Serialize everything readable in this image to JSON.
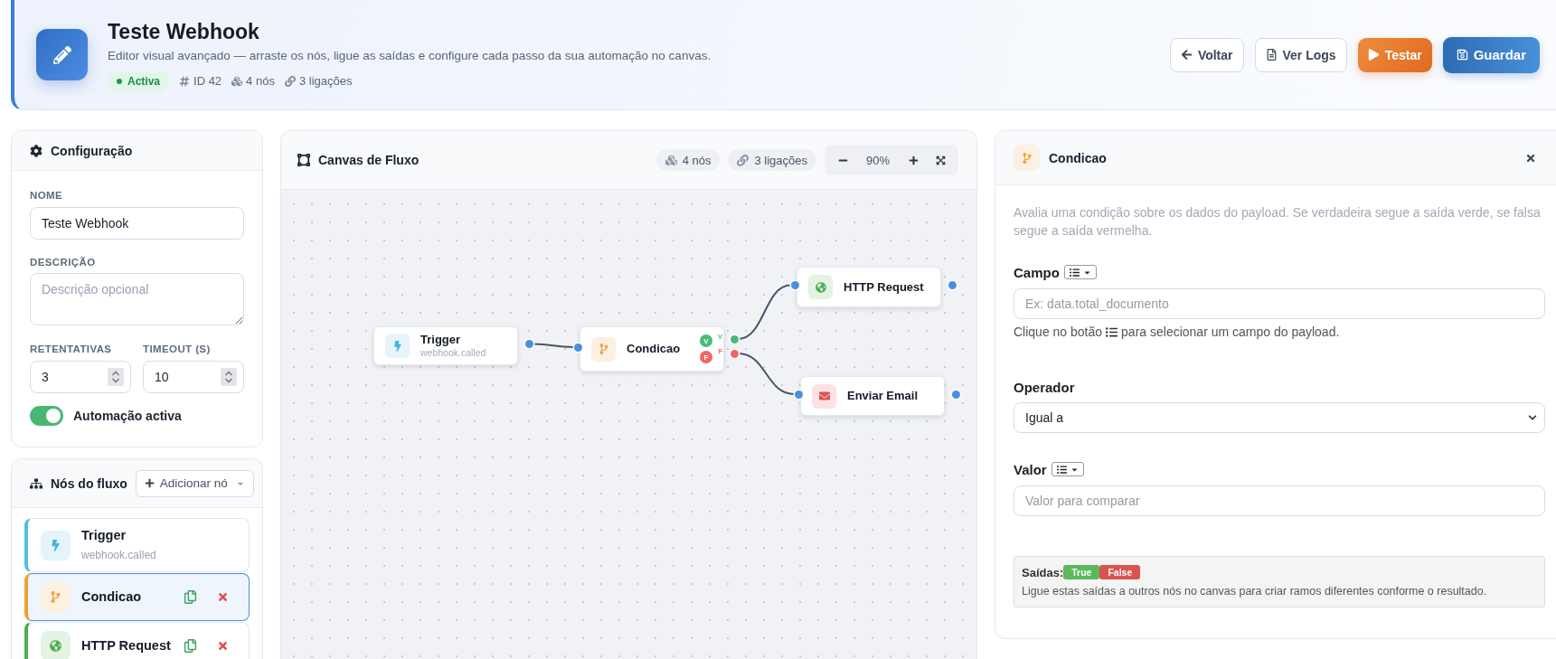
{
  "header": {
    "title": "Teste Webhook",
    "subtitle": "Editor visual avançado — arraste os nós, ligue as saídas e configure cada passo da sua automação no canvas.",
    "status": "Activa",
    "meta": [
      {
        "kind": "id",
        "label": "ID 42"
      },
      {
        "kind": "nodes",
        "label": "4 nós"
      },
      {
        "kind": "links",
        "label": "3 ligações"
      }
    ],
    "actions": [
      {
        "kind": "back",
        "label": "Voltar"
      },
      {
        "kind": "logs",
        "label": "Ver Logs"
      },
      {
        "kind": "test",
        "label": "Testar"
      },
      {
        "kind": "save",
        "label": "Guardar"
      }
    ]
  },
  "config": {
    "title": "Configuração",
    "name": {
      "label": "NOME",
      "value": "Teste Webhook"
    },
    "description": {
      "label": "DESCRIÇÃO",
      "placeholder": "Descrição opcional"
    },
    "retries": {
      "label": "RETENTATIVAS",
      "value": "3"
    },
    "timeout": {
      "label": "TIMEOUT (S)",
      "value": "10"
    },
    "toggle": {
      "label": "Automação activa",
      "on": true
    }
  },
  "flow_nodes": {
    "title": "Nós do fluxo",
    "add_button": "Adicionar nó",
    "items": [
      {
        "kind": "trigger",
        "name": "Trigger",
        "subtitle": "webhook.called",
        "selected": false,
        "actions": false
      },
      {
        "kind": "condition",
        "name": "Condicao",
        "selected": true,
        "actions": true
      },
      {
        "kind": "http",
        "name": "HTTP Request",
        "selected": false,
        "actions": true
      }
    ]
  },
  "canvas": {
    "title": "Canvas de Fluxo",
    "stats": [
      {
        "kind": "nodes",
        "label": "4 nós"
      },
      {
        "kind": "links",
        "label": "3 ligações"
      }
    ],
    "zoom": "90%",
    "nodes": [
      {
        "kind": "trigger",
        "name": "Trigger",
        "subtitle": "webhook.called"
      },
      {
        "kind": "condition",
        "name": "Condicao",
        "outputs": [
          {
            "badge": "V",
            "port_label": "V",
            "color": "#48bb78"
          },
          {
            "badge": "F",
            "port_label": "F",
            "color": "#f56565"
          }
        ]
      },
      {
        "kind": "http",
        "name": "HTTP Request"
      },
      {
        "kind": "email",
        "name": "Enviar Email"
      }
    ]
  },
  "inspector": {
    "kind": "condition",
    "title": "Condicao",
    "description": "Avalia uma condição sobre os dados do payload. Se verdadeira segue a saída verde, se falsa segue a saída vermelha.",
    "fields": [
      {
        "kind": "text",
        "label": "Campo",
        "picker": true,
        "placeholder": "Ex: data.total_documento",
        "hint_before": "Clique no botão",
        "hint_after": "para selecionar um campo do payload."
      },
      {
        "kind": "select",
        "label": "Operador",
        "value": "Igual a"
      },
      {
        "kind": "text",
        "label": "Valor",
        "picker": true,
        "placeholder": "Valor para comparar"
      }
    ],
    "outputs": {
      "label": "Saídas:",
      "badges": [
        {
          "label": "True",
          "color": "#5cb85c"
        },
        {
          "label": "False",
          "color": "#d9534f"
        }
      ],
      "note": "Ligue estas saídas a outros nós no canvas para criar ramos diferentes conforme o resultado."
    }
  }
}
